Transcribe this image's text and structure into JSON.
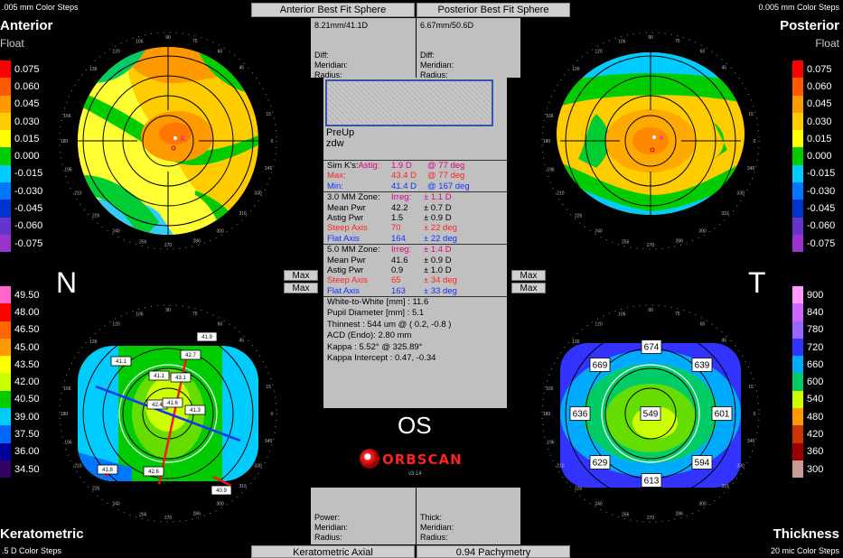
{
  "tabs": {
    "anterior_bfs": "Anterior Best Fit Sphere",
    "posterior_bfs": "Posterior Best Fit Sphere",
    "keratometric": "Keratometric Axial",
    "pachymetry": "0.94 Pachymetry"
  },
  "anterior": {
    "steps": ".005 mm Color Steps",
    "title": "Anterior",
    "subtitle": "Float",
    "bfs": "8.21mm/41.1D",
    "diff": "Diff:",
    "meridian": "Meridian:",
    "radius": "Radius:",
    "scale": [
      "0.075",
      "0.060",
      "0.045",
      "0.030",
      "0.015",
      "0.000",
      "-0.015",
      "-0.030",
      "-0.045",
      "-0.060",
      "-0.075"
    ]
  },
  "posterior": {
    "steps": "0.005 mm Color Steps",
    "title": "Posterior",
    "subtitle": "Float",
    "bfs": "6.67mm/50.6D",
    "diff": "Diff:",
    "meridian": "Meridian:",
    "radius": "Radius:",
    "scale": [
      "0.075",
      "0.060",
      "0.045",
      "0.030",
      "0.015",
      "0.000",
      "-0.015",
      "-0.030",
      "-0.045",
      "-0.060",
      "-0.075"
    ]
  },
  "keratometric": {
    "title": "Keratometric",
    "steps": ".5 D Color Steps",
    "power": "Power:",
    "meridian": "Meridian:",
    "radius": "Radius:",
    "scale": [
      "49.50",
      "48.00",
      "46.50",
      "45.00",
      "43.50",
      "42.00",
      "40.50",
      "39.00",
      "37.50",
      "36.00",
      "34.50"
    ],
    "labels": [
      "41.9",
      "42.7",
      "41.1",
      "41.1",
      "43.1",
      "42.4",
      "41.6",
      "41.3",
      "41.8",
      "42.6",
      "40.9"
    ]
  },
  "thickness": {
    "title": "Thickness",
    "steps": "20 mic Color Steps",
    "thick": "Thick:",
    "meridian": "Meridian:",
    "radius": "Radius:",
    "scale": [
      "900",
      "840",
      "780",
      "720",
      "660",
      "600",
      "540",
      "480",
      "420",
      "360",
      "300"
    ],
    "labels": [
      "674",
      "669",
      "639",
      "636",
      "549",
      "601",
      "629",
      "594",
      "613"
    ]
  },
  "side_labels": {
    "nasal": "N",
    "temporal": "T"
  },
  "max_label": "Max",
  "axis_degrees": [
    "106",
    "90",
    "75",
    "120",
    "60",
    "136",
    "45",
    "166",
    "15",
    "180",
    "0",
    "196",
    "345",
    "210",
    "330",
    "226",
    "316",
    "240",
    "300",
    "256",
    "270",
    "286"
  ],
  "patient": {
    "status": "PreUp",
    "name": "zdw",
    "eye": "OS"
  },
  "stats": {
    "simk": [
      {
        "label": "Sim K's:",
        "tag": "Astig:",
        "val": "1.9 D",
        "val2": "@ 77 deg"
      },
      {
        "label": "",
        "tag": "Max:",
        "val": "43.4 D",
        "val2": "@ 77 deg"
      },
      {
        "label": "",
        "tag": "Min:",
        "val": "41.4 D",
        "val2": "@ 167 deg"
      }
    ],
    "zone3": [
      {
        "label": "3.0 MM Zone:",
        "val": "Irreg:",
        "val2": "± 1.1 D"
      },
      {
        "label": "Mean Pwr",
        "val": "42.2",
        "val2": "± 0.7 D"
      },
      {
        "label": "Astig Pwr",
        "val": "1.5",
        "val2": "± 0.9 D"
      },
      {
        "label": "Steep Axis",
        "val": "70",
        "val2": "± 22 deg"
      },
      {
        "label": "Flat Axis",
        "val": "164",
        "val2": "± 22 deg"
      }
    ],
    "zone5": [
      {
        "label": "5.0 MM Zone:",
        "val": "Irreg:",
        "val2": "± 1.4 D"
      },
      {
        "label": "Mean Pwr",
        "val": "41.6",
        "val2": "± 0.9 D"
      },
      {
        "label": "Astig Pwr",
        "val": "0.9",
        "val2": "± 1.0 D"
      },
      {
        "label": "Steep Axis",
        "val": "65",
        "val2": "± 34 deg"
      },
      {
        "label": "Flat Axis",
        "val": "163",
        "val2": "± 33 deg"
      }
    ],
    "misc": [
      "White-to-White [mm] : 11.6",
      "Pupil Diameter [mm] : 5.1",
      "Thinnest : 544 um @ ( 0.2, -0.8 )",
      "ACD (Endo): 2.80 mm",
      "Kappa : 5.52° @ 325.89°",
      "Kappa Intercept : 0.47, -0.34"
    ]
  },
  "brand": {
    "name": "ORBSCAN",
    "version": "v3.14"
  },
  "colors": {
    "panel_gray": "#c0c0c0",
    "steep_red": "#ff2222",
    "flat_blue": "#1133ff",
    "astig_magenta": "#e0008a",
    "float_scale": [
      "#ff0000",
      "#ff5a00",
      "#ff9900",
      "#ffcc00",
      "#ffff00",
      "#00cc00",
      "#00ccff",
      "#0077ff",
      "#0033cc",
      "#6633cc",
      "#9933cc"
    ],
    "kera_scale": [
      "#ff66cc",
      "#ff0000",
      "#ff6600",
      "#ff9900",
      "#ffff00",
      "#ccff00",
      "#00cc00",
      "#00ccff",
      "#0066ff",
      "#000099",
      "#330066"
    ],
    "thick_scale": [
      "#ff99ff",
      "#cc66ff",
      "#9966ff",
      "#3333ff",
      "#00aaff",
      "#00cc66",
      "#ccff00",
      "#ff9900",
      "#cc3300",
      "#990000",
      "#cc9999"
    ]
  }
}
